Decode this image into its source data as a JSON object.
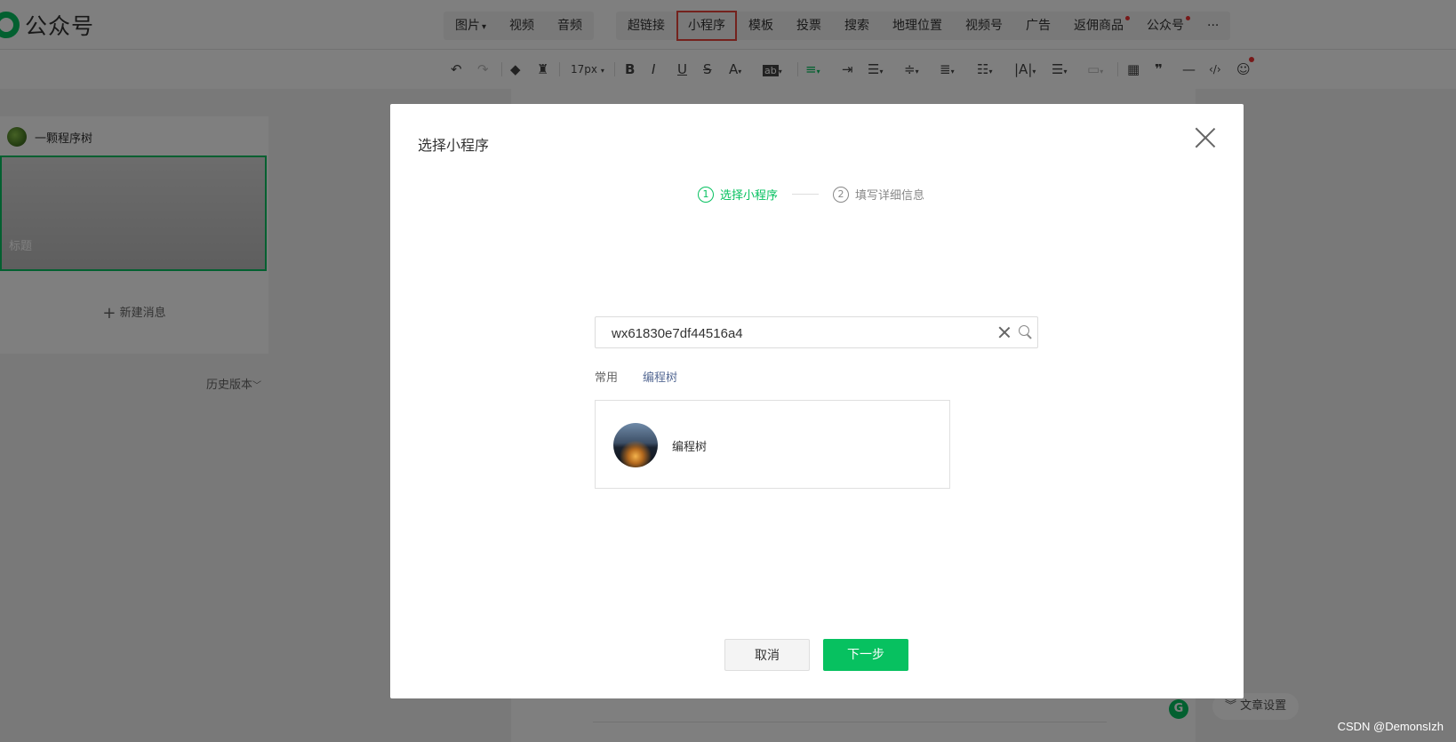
{
  "app": {
    "name": "公众号"
  },
  "insert_menu": {
    "group1": [
      {
        "label": "图片",
        "caret": "▾"
      },
      {
        "label": "视频"
      },
      {
        "label": "音频"
      }
    ],
    "group2": [
      {
        "label": "超链接"
      },
      {
        "label": "小程序",
        "highlighted": true
      },
      {
        "label": "模板"
      },
      {
        "label": "投票"
      },
      {
        "label": "搜索"
      },
      {
        "label": "地理位置"
      },
      {
        "label": "视频号"
      },
      {
        "label": "广告"
      },
      {
        "label": "返佣商品",
        "dot": true
      },
      {
        "label": "公众号",
        "dot": true
      },
      {
        "label": "···"
      }
    ]
  },
  "format_toolbar": {
    "font_size": "17px",
    "icons": [
      "undo-icon",
      "redo-icon",
      "format-painter-icon",
      "clear-format-icon",
      "bold-icon",
      "italic-icon",
      "underline-icon",
      "strikethrough-icon",
      "font-color-icon",
      "background-color-icon",
      "align-icon",
      "indent-icon",
      "first-line-indent-icon",
      "line-height-icon",
      "paragraph-spacing-icon",
      "list-spacing-icon",
      "letter-spacing-icon",
      "bullet-list-icon",
      "text-box-icon",
      "table-icon",
      "quote-icon",
      "divider-icon",
      "code-icon",
      "emoji-icon"
    ]
  },
  "left_panel": {
    "account_name": "一颗程序树",
    "cover_title_placeholder": "标题",
    "new_message": "新建消息",
    "history_version": "历史版本"
  },
  "editor": {
    "article_settings": "文章设置"
  },
  "modal": {
    "title": "选择小程序",
    "steps": [
      {
        "num": "1",
        "label": "选择小程序"
      },
      {
        "num": "2",
        "label": "填写详细信息"
      }
    ],
    "search": {
      "value": "wx61830e7df44516a4"
    },
    "tabs": [
      {
        "label": "常用"
      },
      {
        "label": "编程树"
      }
    ],
    "results": [
      {
        "name": "编程树"
      }
    ],
    "buttons": {
      "cancel": "取消",
      "next": "下一步"
    }
  },
  "watermark": "CSDN @DemonsIzh",
  "colors": {
    "accent": "#07c160",
    "highlight": "#e8443a",
    "tab_active": "#576b95"
  }
}
